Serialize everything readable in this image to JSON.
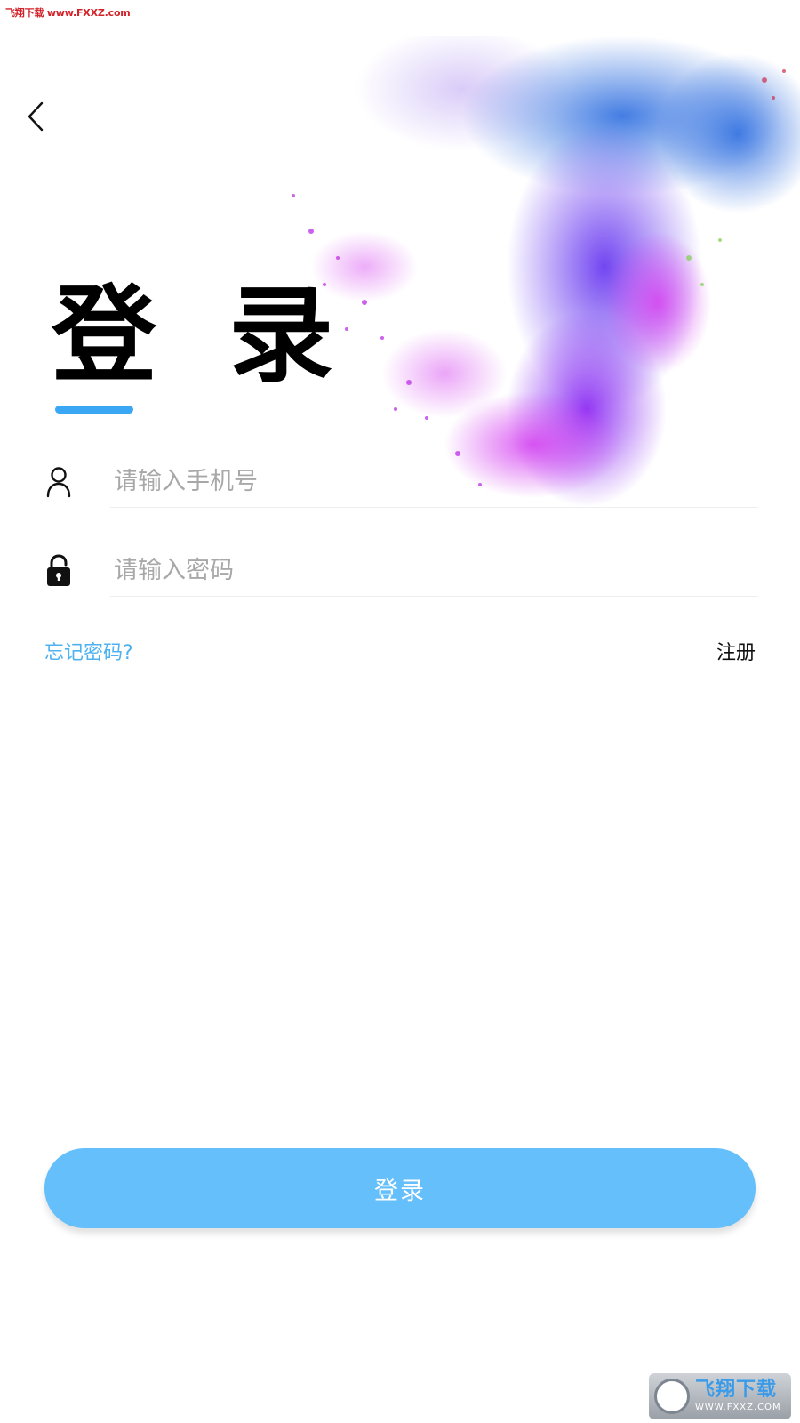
{
  "watermark_top": "飞翔下载 www.FXXZ.com",
  "title": "登 录",
  "phone": {
    "placeholder": "请输入手机号",
    "value": ""
  },
  "password": {
    "placeholder": "请输入密码",
    "value": ""
  },
  "links": {
    "forgot": "忘记密码?",
    "register": "注册"
  },
  "login_button": "登录",
  "watermark_bottom": {
    "main": "飞翔下载",
    "url": "WWW.FXXZ.COM"
  },
  "colors": {
    "accent": "#64bffb",
    "link": "#4fb2f0",
    "underline": "#3aa7f5"
  },
  "icons": {
    "back": "chevron-left-icon",
    "phone": "user-icon",
    "password": "lock-icon"
  }
}
